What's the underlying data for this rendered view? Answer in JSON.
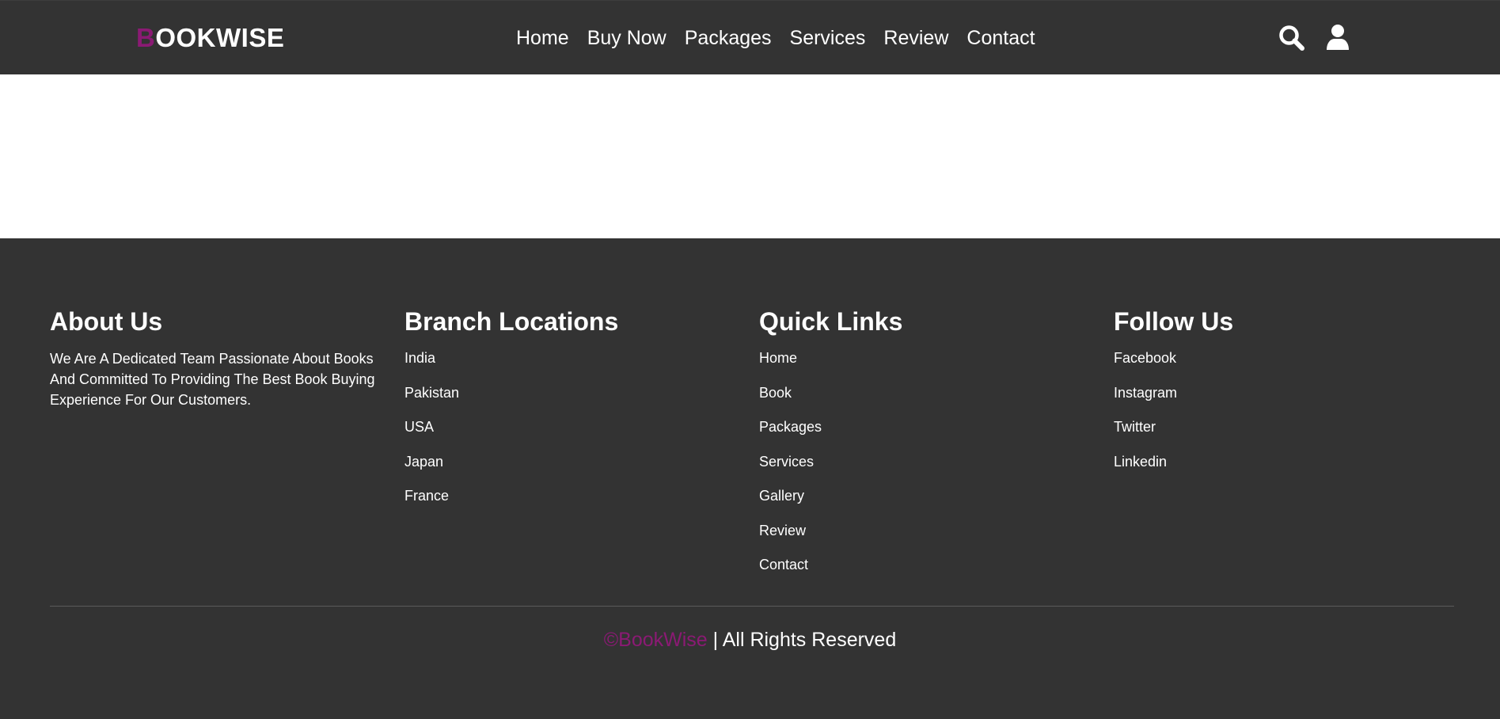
{
  "colors": {
    "background_dark": "#333333",
    "accent": "#8b1a74",
    "text": "#ffffff",
    "hero_background": "#ffffff"
  },
  "header": {
    "logo_first_letter": "B",
    "logo_rest": "OOKWISE",
    "nav": [
      "Home",
      "Buy Now",
      "Packages",
      "Services",
      "Review",
      "Contact"
    ],
    "icons": [
      "search-icon",
      "user-icon"
    ]
  },
  "footer": {
    "about": {
      "title": "About Us",
      "text": "We Are A Dedicated Team Passionate About Books And Committed To Providing The Best Book Buying Experience For Our Customers."
    },
    "branches": {
      "title": "Branch Locations",
      "items": [
        "India",
        "Pakistan",
        "USA",
        "Japan",
        "France"
      ]
    },
    "quick_links": {
      "title": "Quick Links",
      "items": [
        "Home",
        "Book",
        "Packages",
        "Services",
        "Gallery",
        "Review",
        "Contact"
      ]
    },
    "follow": {
      "title": "Follow Us",
      "items": [
        "Facebook",
        "Instagram",
        "Twitter",
        "Linkedin"
      ]
    },
    "copyright_brand": "©BookWise",
    "copyright_rest": " | All Rights Reserved"
  }
}
